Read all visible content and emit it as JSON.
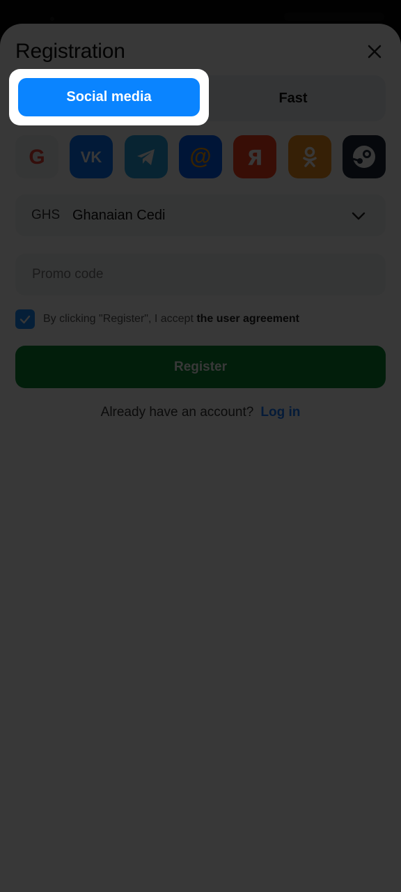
{
  "header": {
    "title": "Registration"
  },
  "tabs": [
    {
      "label": "Social media",
      "active": true
    },
    {
      "label": "Fast",
      "active": false
    }
  ],
  "social_icons": [
    "google-icon",
    "vk-icon",
    "telegram-icon",
    "mail-ru-icon",
    "yandex-icon",
    "odnoklassniki-icon",
    "steam-icon"
  ],
  "currency": {
    "code": "GHS",
    "name": "Ghanaian Cedi"
  },
  "promo": {
    "placeholder": "Promo code",
    "value": ""
  },
  "agreement": {
    "checked": true,
    "text": "By clicking \"Register\", I accept ",
    "link": "the user agreement"
  },
  "register": {
    "label": "Register"
  },
  "login": {
    "text": "Already have an account?",
    "link": "Log in"
  },
  "colors": {
    "accent": "#0a84ff",
    "register_green": "#0c8a33",
    "link_blue": "#1a7bff",
    "overlay": "rgba(0,0,0,0.78)"
  }
}
